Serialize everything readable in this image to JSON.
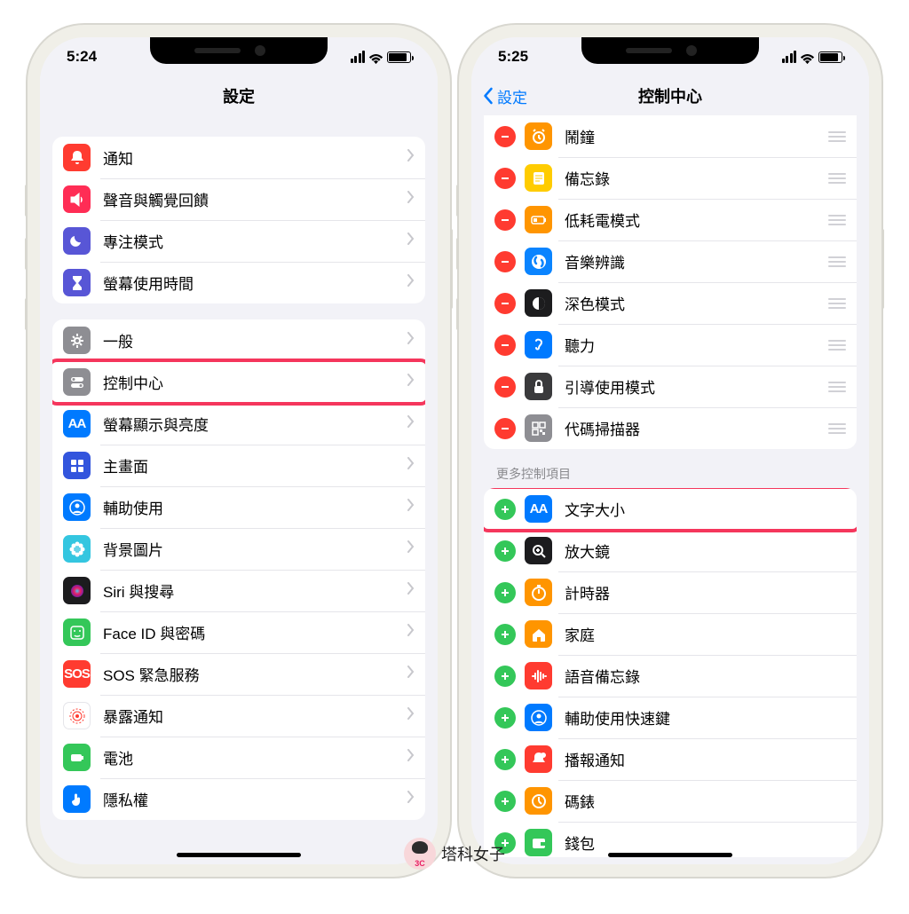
{
  "watermark": "塔科女子",
  "left": {
    "time": "5:24",
    "title": "設定",
    "group1": [
      {
        "label": "通知",
        "icon": "bell",
        "bg": "#ff3b30"
      },
      {
        "label": "聲音與觸覺回饋",
        "icon": "speaker",
        "bg": "#ff2d55"
      },
      {
        "label": "專注模式",
        "icon": "moon",
        "bg": "#5856d6"
      },
      {
        "label": "螢幕使用時間",
        "icon": "hourglass",
        "bg": "#5856d6"
      }
    ],
    "group2": [
      {
        "label": "一般",
        "icon": "gear",
        "bg": "#8e8e93"
      },
      {
        "label": "控制中心",
        "icon": "toggles",
        "bg": "#8e8e93",
        "highlight": true
      },
      {
        "label": "螢幕顯示與亮度",
        "icon": "AA",
        "bg": "#007aff",
        "txt": true
      },
      {
        "label": "主畫面",
        "icon": "grid",
        "bg": "#3355dd"
      },
      {
        "label": "輔助使用",
        "icon": "person",
        "bg": "#007aff"
      },
      {
        "label": "背景圖片",
        "icon": "flower",
        "bg": "#34c6e0"
      },
      {
        "label": "Siri 與搜尋",
        "icon": "siri",
        "bg": "#1c1c1e"
      },
      {
        "label": "Face ID 與密碼",
        "icon": "face",
        "bg": "#34c759"
      },
      {
        "label": "SOS 緊急服務",
        "icon": "SOS",
        "bg": "#ff3b30",
        "txt": true
      },
      {
        "label": "暴露通知",
        "icon": "burst",
        "bg": "#ffffff",
        "fg": "#ff3b30",
        "border": true
      },
      {
        "label": "電池",
        "icon": "batt",
        "bg": "#34c759"
      },
      {
        "label": "隱私權",
        "icon": "hand",
        "bg": "#007aff"
      }
    ]
  },
  "right": {
    "time": "5:25",
    "back": "設定",
    "title": "控制中心",
    "included": [
      {
        "label": "鬧鐘",
        "icon": "alarm",
        "bg": "#ff9500"
      },
      {
        "label": "備忘錄",
        "icon": "note",
        "bg": "#ffcc00"
      },
      {
        "label": "低耗電模式",
        "icon": "lowbatt",
        "bg": "#ff9500"
      },
      {
        "label": "音樂辨識",
        "icon": "shazam",
        "bg": "#0a84ff"
      },
      {
        "label": "深色模式",
        "icon": "dark",
        "bg": "#1c1c1e"
      },
      {
        "label": "聽力",
        "icon": "ear",
        "bg": "#007aff"
      },
      {
        "label": "引導使用模式",
        "icon": "lock",
        "bg": "#3a3a3c"
      },
      {
        "label": "代碼掃描器",
        "icon": "qr",
        "bg": "#8e8e93"
      }
    ],
    "more_header": "更多控制項目",
    "more": [
      {
        "label": "文字大小",
        "icon": "AA",
        "bg": "#007aff",
        "txt": true,
        "highlight": true
      },
      {
        "label": "放大鏡",
        "icon": "mag",
        "bg": "#1c1c1e"
      },
      {
        "label": "計時器",
        "icon": "timer",
        "bg": "#ff9500"
      },
      {
        "label": "家庭",
        "icon": "home",
        "bg": "#ff9500"
      },
      {
        "label": "語音備忘錄",
        "icon": "wave",
        "bg": "#ff3b30"
      },
      {
        "label": "輔助使用快速鍵",
        "icon": "person",
        "bg": "#007aff"
      },
      {
        "label": "播報通知",
        "icon": "bellred",
        "bg": "#ff3b30"
      },
      {
        "label": "碼錶",
        "icon": "stop",
        "bg": "#ff9500"
      },
      {
        "label": "錢包",
        "icon": "wallet",
        "bg": "#34c759"
      }
    ]
  }
}
